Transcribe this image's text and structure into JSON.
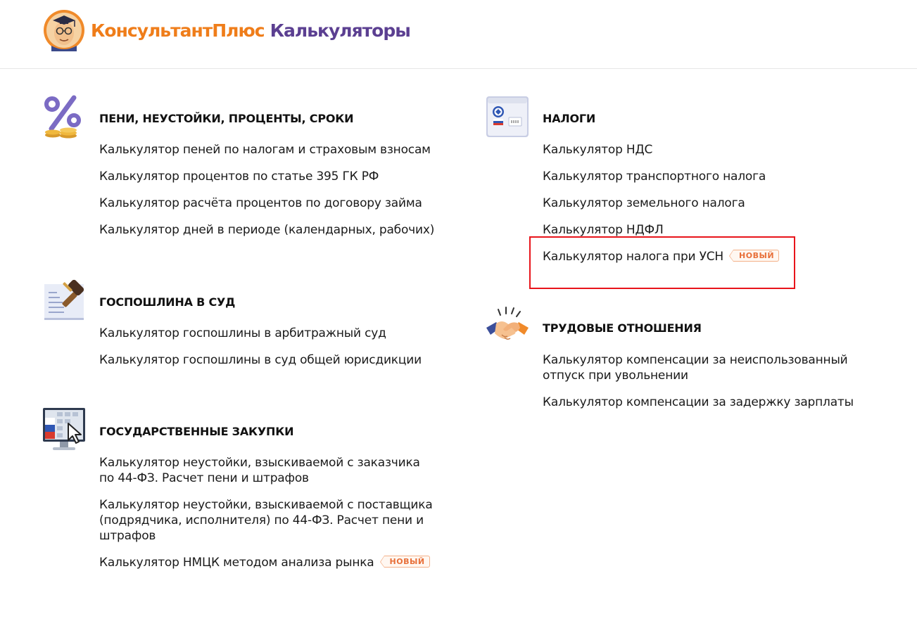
{
  "header": {
    "brand_part1": "КонсультантПлюс",
    "brand_part2": "Калькуляторы"
  },
  "colors": {
    "brand_orange": "#ef7d1a",
    "brand_purple": "#5b3f91",
    "badge": "#e8703a",
    "highlight": "#e8141b"
  },
  "sections": {
    "peni": {
      "icon": "percent-coins-icon",
      "title": "ПЕНИ, НЕУСТОЙКИ, ПРОЦЕНТЫ, СРОКИ",
      "links": [
        "Калькулятор пеней по налогам и страховым взносам",
        "Калькулятор процентов по статье 395 ГК РФ",
        "Калькулятор расчёта процентов по договору займа",
        "Калькулятор дней в периоде (календарных, рабочих)"
      ]
    },
    "gosposhlina": {
      "icon": "gavel-document-icon",
      "title": "ГОСПОШЛИНА В СУД",
      "links": [
        "Калькулятор госпошлины в арбитражный суд",
        "Калькулятор госпошлины в суд общей юрисдикции"
      ]
    },
    "zakupki": {
      "icon": "monitor-cursor-icon",
      "title": "ГОСУДАРСТВЕННЫЕ ЗАКУПКИ",
      "links": [
        "Калькулятор неустойки, взыскиваемой с заказчика по 44-ФЗ. Расчет пени и штрафов",
        "Калькулятор неустойки, взыскиваемой с поставщика (подрядчика, исполнителя) по 44-ФЗ. Расчет пени и штрафов",
        "Калькулятор НМЦК методом анализа рынка"
      ],
      "badge": "НОВЫЙ"
    },
    "nalogi": {
      "icon": "tax-terminal-icon",
      "title": "НАЛОГИ",
      "links": [
        "Калькулятор НДС",
        "Калькулятор транспортного налога",
        "Калькулятор земельного налога",
        "Калькулятор НДФЛ",
        "Калькулятор налога при УСН"
      ],
      "badge": "НОВЫЙ"
    },
    "trud": {
      "icon": "handshake-icon",
      "title": "ТРУДОВЫЕ ОТНОШЕНИЯ",
      "links": [
        "Калькулятор компенсации за неиспользованный отпуск при увольнении",
        "Калькулятор компенсации за задержку зарплаты"
      ]
    }
  }
}
